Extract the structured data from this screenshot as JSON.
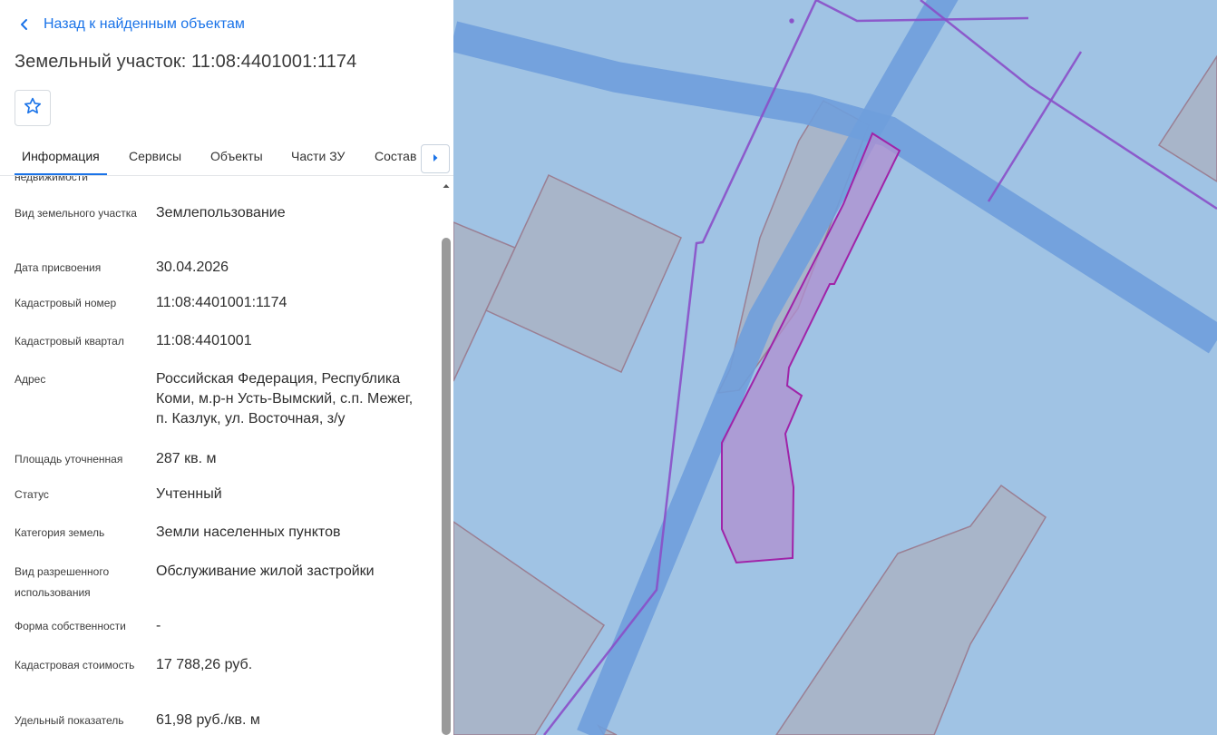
{
  "back_label": "Назад к найденным объектам",
  "title": "Земельный участок: 11:08:4401001:1174",
  "tabs": [
    {
      "label": "Информация"
    },
    {
      "label": "Сервисы"
    },
    {
      "label": "Объекты"
    },
    {
      "label": "Части ЗУ"
    },
    {
      "label": "Состав"
    }
  ],
  "clipped_label": "недвижимости",
  "fields": [
    {
      "label": "Вид земельного участка",
      "value": "Землепользование"
    },
    {
      "label": "Дата присвоения",
      "value": "30.04.2026"
    },
    {
      "label": "Кадастровый номер",
      "value": "11:08:4401001:1174"
    },
    {
      "label": "Кадастровый квартал",
      "value": "11:08:4401001"
    },
    {
      "label": "Адрес",
      "value": "Российская Федерация, Республика Коми, м.р-н Усть-Вымский, с.п. Межег, п. Казлук, ул. Восточная, з/у"
    },
    {
      "label": "Площадь уточненная",
      "value": "287 кв. м"
    },
    {
      "label": "Статус",
      "value": "Учтенный"
    },
    {
      "label": "Категория земель",
      "value": "Земли населенных пунктов"
    },
    {
      "label": "Вид разрешенного использования",
      "value": "Обслуживание жилой застройки"
    },
    {
      "label": "Форма собственности",
      "value": "-"
    },
    {
      "label": "Кадастровая стоимость",
      "value": "17 788,26 руб."
    },
    {
      "label": "Удельный показатель",
      "value": "61,98 руб./кв. м"
    }
  ],
  "colors": {
    "accent": "#1a73e8",
    "map_background": "#a0c3e4",
    "road": "#6f9fdc",
    "parcel_fill": "#a9b3c4",
    "parcel_stroke": "#9a7f93",
    "selected_parcel": "#b08fd0",
    "boundary_line": "#8a4fc8"
  },
  "icons": {
    "back": "chevron-left-icon",
    "favorite": "star-outline-icon",
    "tabs_next": "caret-right-icon"
  }
}
